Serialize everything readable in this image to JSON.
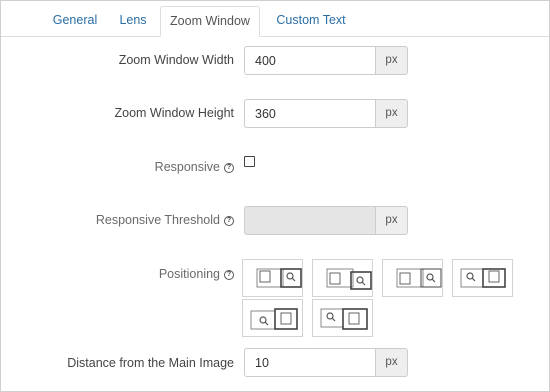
{
  "tabs": [
    {
      "label": "General",
      "active": false
    },
    {
      "label": "Lens",
      "active": false
    },
    {
      "label": "Zoom Window",
      "active": true
    },
    {
      "label": "Custom Text",
      "active": false
    }
  ],
  "fields": {
    "zoom_window_width": {
      "label": "Zoom Window Width",
      "value": "400",
      "unit": "px"
    },
    "zoom_window_height": {
      "label": "Zoom Window Height",
      "value": "360",
      "unit": "px"
    },
    "responsive": {
      "label": "Responsive",
      "checked": false
    },
    "responsive_threshold": {
      "label": "Responsive Threshold",
      "value": "",
      "unit": "px",
      "disabled": true
    },
    "positioning": {
      "label": "Positioning",
      "options": [
        {
          "icon": "zoom-window-right-top-icon"
        },
        {
          "icon": "zoom-window-right-middle-icon"
        },
        {
          "icon": "zoom-window-right-bottom-icon"
        },
        {
          "icon": "zoom-window-left-top-icon"
        },
        {
          "icon": "zoom-window-left-middle-icon"
        },
        {
          "icon": "zoom-window-left-bottom-icon"
        }
      ]
    },
    "distance_from_main_image": {
      "label": "Distance from the Main Image",
      "value": "10",
      "unit": "px"
    }
  },
  "colors": {
    "link": "#2a6ea6",
    "border": "#cccccc",
    "addon_bg": "#eeeeee",
    "disabled_bg": "#e5e5e5"
  }
}
